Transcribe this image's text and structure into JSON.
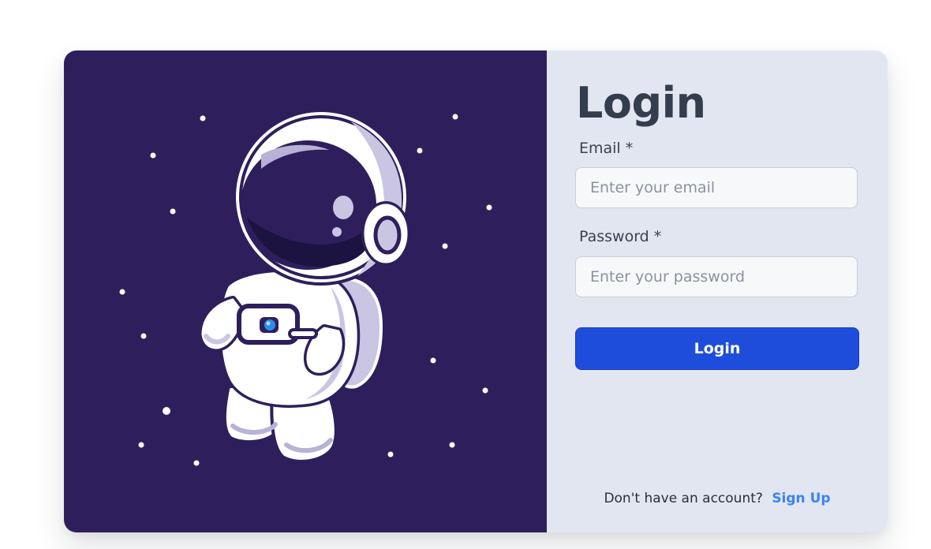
{
  "login": {
    "title": "Login",
    "email_label": "Email *",
    "email_placeholder": "Enter your email",
    "email_value": "",
    "password_label": "Password *",
    "password_placeholder": "Enter your password",
    "password_value": "",
    "submit_label": "Login",
    "signup_prompt": "Don't have an account?",
    "signup_link": "Sign Up"
  },
  "illustration": {
    "icon": "astronaut-illustration",
    "background": "#2e1f5c"
  },
  "colors": {
    "button": "#1f4ddb",
    "link": "#3b82f6",
    "form_background": "#e1e6f0",
    "title": "#343d4e"
  }
}
